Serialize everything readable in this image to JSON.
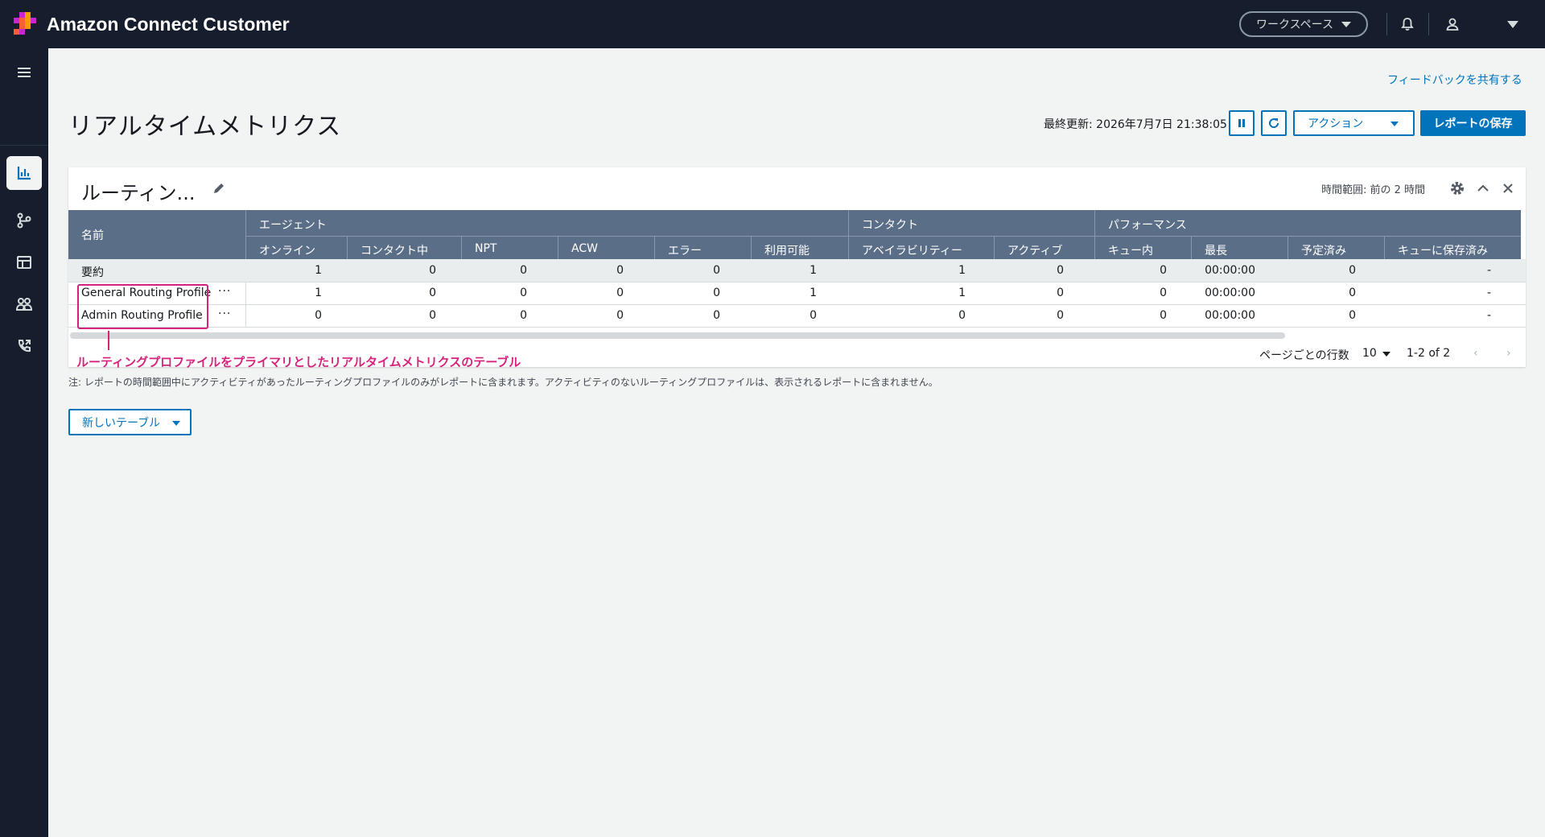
{
  "topbar": {
    "app_title": "Amazon Connect Customer",
    "workspace_label": "ワークスペース"
  },
  "main": {
    "feedback_link": "フィードバックを共有する",
    "page_title": "リアルタイムメトリクス",
    "last_updated": "最終更新: 2026年7月7日 21:38:05",
    "actions_label": "アクション",
    "save_report_label": "レポートの保存",
    "note": "注: レポートの時間範囲中にアクティビティがあったルーティングプロファイルのみがレポートに含まれます。アクティビティのないルーティングプロファイルは、表示されるレポートに含まれません。",
    "new_table_label": "新しいテーブル"
  },
  "card": {
    "title": "ルーティン...",
    "time_range": "時間範囲: 前の 2 時間",
    "rows_per_page_label": "ページごとの行数",
    "rows_per_page_value": "10",
    "page_info": "1-2 of 2"
  },
  "table": {
    "name_header": "名前",
    "groups": [
      "エージェント",
      "コンタクト",
      "パフォーマンス"
    ],
    "columns": [
      "オンライン",
      "コンタクト中",
      "NPT",
      "ACW",
      "エラー",
      "利用可能",
      "アベイラビリティー",
      "アクティブ",
      "キュー内",
      "最長",
      "予定済み",
      "キューに保存済み"
    ],
    "rows": [
      {
        "name": "要約",
        "values": [
          "1",
          "0",
          "0",
          "0",
          "0",
          "1",
          "1",
          "0",
          "0",
          "00:00:00",
          "0",
          "-"
        ]
      },
      {
        "name": "General Routing Profile",
        "values": [
          "1",
          "0",
          "0",
          "0",
          "0",
          "1",
          "1",
          "0",
          "0",
          "00:00:00",
          "0",
          "-"
        ]
      },
      {
        "name": "Admin Routing Profile",
        "values": [
          "0",
          "0",
          "0",
          "0",
          "0",
          "0",
          "0",
          "0",
          "0",
          "00:00:00",
          "0",
          "-"
        ]
      }
    ]
  },
  "annotation": {
    "callout": "ルーティングプロファイルをプライマリとしたリアルタイムメトリクスのテーブル",
    "color": "#d6227c"
  },
  "icons": {
    "nav": [
      "menu-icon",
      "dashboard-icon",
      "analytics-icon",
      "routing-icon",
      "table-icon",
      "users-icon",
      "phone-icon"
    ],
    "topbar": [
      "bell-icon",
      "user-icon",
      "caret-down-icon"
    ]
  },
  "colors": {
    "topbar_bg": "#161e2d",
    "accent": "#0073bb",
    "table_header_bg": "#5b6e88"
  }
}
